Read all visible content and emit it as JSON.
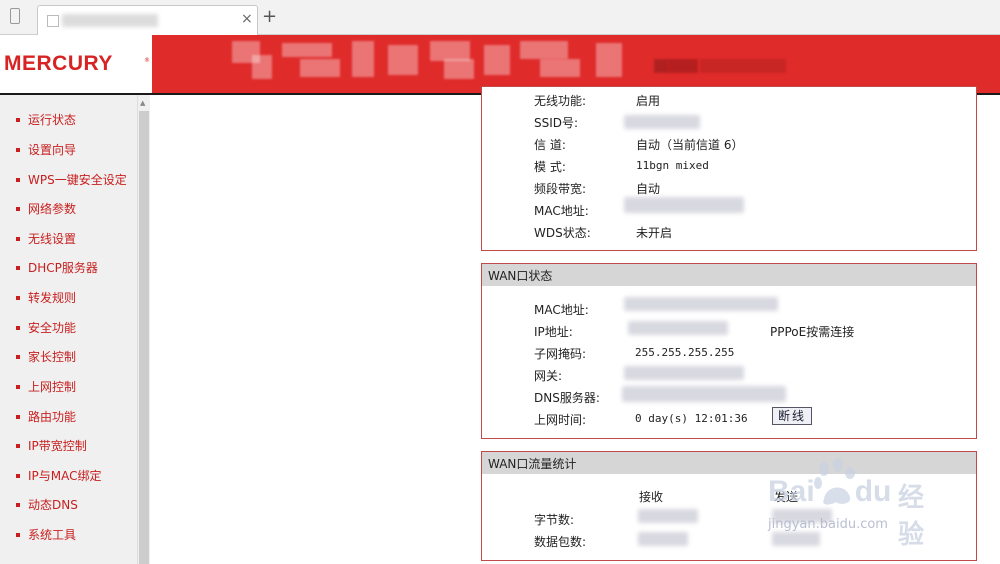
{
  "browser": {
    "tab_close": "×",
    "new_tab": "+"
  },
  "header": {
    "logo": "MERCURY",
    "logo_mark": "®"
  },
  "sidebar": {
    "items": [
      {
        "label": "运行状态"
      },
      {
        "label": "设置向导"
      },
      {
        "label": "WPS一键安全设定"
      },
      {
        "label": "网络参数"
      },
      {
        "label": "无线设置"
      },
      {
        "label": "DHCP服务器"
      },
      {
        "label": "转发规则"
      },
      {
        "label": "安全功能"
      },
      {
        "label": "家长控制"
      },
      {
        "label": "上网控制"
      },
      {
        "label": "路由功能"
      },
      {
        "label": "IP带宽控制"
      },
      {
        "label": "IP与MAC绑定"
      },
      {
        "label": "动态DNS"
      },
      {
        "label": "系统工具"
      }
    ]
  },
  "wireless": {
    "rows": [
      {
        "label": "无线功能:",
        "value": "启用"
      },
      {
        "label": "SSID号:",
        "value": ""
      },
      {
        "label": "信  道:",
        "value": "自动（当前信道 6）"
      },
      {
        "label": "模  式:",
        "value": "11bgn mixed"
      },
      {
        "label": "频段带宽:",
        "value": "自动"
      },
      {
        "label": "MAC地址:",
        "value": ""
      },
      {
        "label": "WDS状态:",
        "value": "未开启"
      }
    ]
  },
  "wan": {
    "title": "WAN口状态",
    "rows": [
      {
        "label": "MAC地址:",
        "value": ""
      },
      {
        "label": "IP地址:",
        "value": ""
      },
      {
        "label": "子网掩码:",
        "value": "255.255.255.255"
      },
      {
        "label": "网关:",
        "value": ""
      },
      {
        "label": "DNS服务器:",
        "value": ""
      },
      {
        "label": "上网时间:",
        "value": "0 day(s) 12:01:36"
      }
    ],
    "connection_type": "PPPoE按需连接",
    "disconnect_button": "断线"
  },
  "traffic": {
    "title": "WAN口流量统计",
    "col_recv": "接收",
    "col_send": "发送",
    "rows": [
      {
        "label": "字节数:"
      },
      {
        "label": "数据包数:"
      }
    ]
  },
  "watermark": {
    "brand": "Bai",
    "brand2": "du",
    "suffix": "经验",
    "url": "jingyan.baidu.com"
  },
  "colors": {
    "header_red": "#e02b2b",
    "nav_red": "#c81e1e",
    "panel_border": "#c04a4a"
  }
}
